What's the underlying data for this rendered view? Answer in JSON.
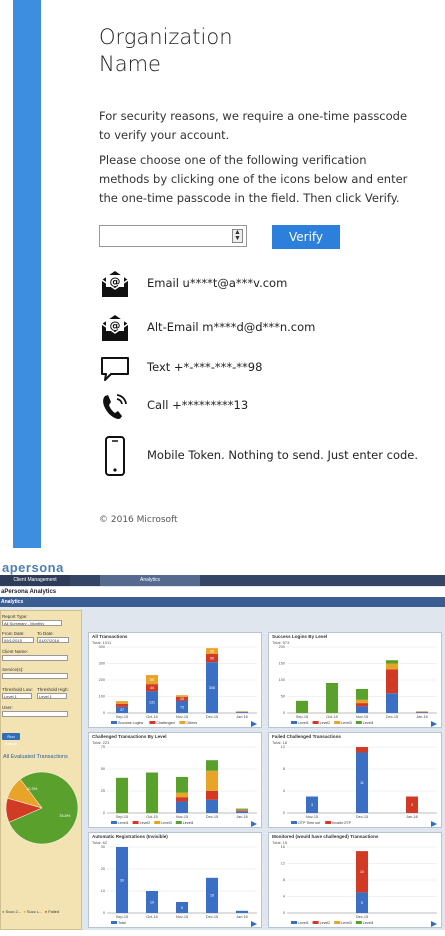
{
  "login": {
    "org_title": "Organization\nName",
    "security_text": "For security reasons, we require a one-time passcode to verify your account.",
    "instructions_text": "Please choose one of the following verification methods by clicking one of the icons below and enter the one-time passcode in the field. Then click Verify.",
    "otp_input": {
      "value": "",
      "placeholder": ""
    },
    "verify_label": "Verify",
    "methods": [
      {
        "icon": "email-icon",
        "label": "Email u****t@a***v.com"
      },
      {
        "icon": "email-icon",
        "label": "Alt-Email m****d@d***n.com"
      },
      {
        "icon": "text-message-icon",
        "label": "Text +*-***-***-**98"
      },
      {
        "icon": "phone-call-icon",
        "label": "Call +*********13"
      },
      {
        "icon": "mobile-token-icon",
        "label": "Mobile Token. Nothing to send. Just enter code."
      }
    ],
    "copyright": "© 2016 Microsoft",
    "accent_color": "#3d8ee0"
  },
  "analytics": {
    "logo": "apersona",
    "nav": {
      "client_management": "Client Management",
      "analytics": "Analytics"
    },
    "title": "aPersona Analytics",
    "bar_label": "Analytics",
    "filters": {
      "report_type_label": "Report Type:",
      "report_type_value": "All Summary - Monthly",
      "from_date_label": "From Date:",
      "from_date_value": "09/1/2015",
      "to_date_label": "To Date:",
      "to_date_value": "01/07/2016",
      "client_name_label": "Client Name:",
      "services_label": "Service(s):",
      "threshold_low_label": "Threshold Low:",
      "threshold_low_value": "Level 1",
      "threshold_high_label": "Threshold High:",
      "threshold_high_value": "Level 1",
      "user_label": "User:",
      "run_report_label": "Run Report",
      "pie_title": "All Evaluated Transactions",
      "pie_values": {
        "success_level": 78.8,
        "success_l": 10.3,
        "failed": 10.9
      },
      "pie_labels": {
        "success_level": "78.8%",
        "success_l": "10.3%"
      },
      "pie_legend": [
        "Succ 2...",
        "Succ L...",
        "Failed"
      ]
    },
    "colors": {
      "level1": "#3a6fc4",
      "level2": "#d13a24",
      "level3": "#e8a329",
      "level4": "#5aa02c",
      "other": "#8fb7e0"
    }
  },
  "chart_data": [
    {
      "type": "bar",
      "title": "All Transactions",
      "subtitle": "Total: 1011",
      "categories": [
        "Sep-15",
        "Oct-15",
        "Nov-15",
        "Dec-15",
        "Jan-16"
      ],
      "ylim": [
        0,
        400
      ],
      "yticks": [
        0,
        100,
        200,
        300,
        400
      ],
      "series": [
        {
          "name": "Success Logins",
          "values": [
            37,
            131,
            73,
            308,
            5
          ]
        },
        {
          "name": "Challenged",
          "values": [
            19,
            44,
            25,
            50,
            3
          ]
        },
        {
          "name": "Others",
          "values": [
            16,
            55,
            10,
            35,
            2
          ]
        }
      ],
      "labels": [
        [
          "37",
          "19",
          "16"
        ],
        [
          "131",
          "44",
          "55"
        ],
        [
          "73",
          "25",
          "10"
        ],
        [
          "308",
          "50",
          "35"
        ],
        [
          "",
          "",
          ""
        ]
      ],
      "legend": [
        "Success Logins",
        "Challenged",
        "Others"
      ]
    },
    {
      "type": "bar",
      "title": "Success Logins By Level",
      "subtitle": "Total: 573",
      "categories": [
        "Sep-15",
        "Oct-15",
        "Nov-15",
        "Dec-15",
        "Jan-16"
      ],
      "ylim": [
        0,
        200
      ],
      "yticks": [
        0,
        50,
        100,
        150,
        200
      ],
      "series": [
        {
          "name": "Level1",
          "values": [
            0,
            0,
            20,
            60,
            2
          ]
        },
        {
          "name": "Level2",
          "values": [
            0,
            0,
            10,
            72,
            1
          ]
        },
        {
          "name": "Level3",
          "values": [
            0,
            0,
            10,
            18,
            1
          ]
        },
        {
          "name": "Level4",
          "values": [
            37,
            91,
            33,
            10,
            1
          ]
        }
      ],
      "legend": [
        "Level1",
        "Level2",
        "Level3",
        "Level4"
      ]
    },
    {
      "type": "bar",
      "title": "Challenged Transactions By Level",
      "subtitle": "Total: 223",
      "categories": [
        "Sep-15",
        "Oct-15",
        "Nov-15",
        "Dec-15",
        "Jan-16"
      ],
      "ylim": [
        0,
        75
      ],
      "yticks": [
        0,
        25,
        50,
        75
      ],
      "series": [
        {
          "name": "Level1",
          "values": [
            0,
            0,
            13,
            15,
            2
          ]
        },
        {
          "name": "Level2",
          "values": [
            0,
            0,
            5,
            10,
            1
          ]
        },
        {
          "name": "Level3",
          "values": [
            0,
            0,
            5,
            23,
            1
          ]
        },
        {
          "name": "Level4",
          "values": [
            40,
            46,
            18,
            12,
            1
          ]
        }
      ],
      "legend": [
        "Level1",
        "Level2",
        "Level3",
        "Level4"
      ]
    },
    {
      "type": "bar",
      "title": "Failed Challenged Transactions",
      "subtitle": "Total: 18",
      "categories": [
        "Nov-15",
        "Dec-15",
        "Jan-16"
      ],
      "ylim": [
        0,
        12
      ],
      "yticks": [
        0,
        4,
        8,
        12
      ],
      "series": [
        {
          "name": "OTP Time out",
          "values": [
            3,
            11,
            0
          ]
        },
        {
          "name": "Invalid OTP",
          "values": [
            0,
            1,
            3
          ]
        }
      ],
      "labels": [
        [
          "3",
          ""
        ],
        [
          "11",
          ""
        ],
        [
          "",
          "3"
        ]
      ],
      "legend": [
        "OTP Time out",
        "Invalid OTP"
      ]
    },
    {
      "type": "bar",
      "title": "Automatic Registrations (Invisible)",
      "subtitle": "Total: 62",
      "categories": [
        "Sep-15",
        "Oct-15",
        "Nov-15",
        "Dec-15",
        "Jan-16"
      ],
      "ylim": [
        0,
        30
      ],
      "yticks": [
        0,
        10,
        20,
        30
      ],
      "series": [
        {
          "name": "Total",
          "values": [
            30,
            10,
            5,
            16,
            1
          ]
        }
      ],
      "labels": [
        [
          "30"
        ],
        [
          "10"
        ],
        [
          "5"
        ],
        [
          "16"
        ],
        [
          ""
        ]
      ],
      "legend": [
        "Total"
      ]
    },
    {
      "type": "bar",
      "title": "Monitored (would have challenged) Transactions",
      "subtitle": "Total: 15",
      "categories": [
        "Dec-15"
      ],
      "ylim": [
        0,
        16
      ],
      "yticks": [
        0,
        4,
        8,
        12,
        16
      ],
      "series": [
        {
          "name": "Level1",
          "values": [
            5
          ]
        },
        {
          "name": "Level2",
          "values": [
            10
          ]
        },
        {
          "name": "Level3",
          "values": [
            0
          ]
        },
        {
          "name": "Level4",
          "values": [
            0
          ]
        }
      ],
      "labels": [
        [
          "5",
          "10",
          "",
          ""
        ]
      ],
      "legend": [
        "Level1",
        "Level2",
        "Level3",
        "Level4"
      ]
    }
  ]
}
